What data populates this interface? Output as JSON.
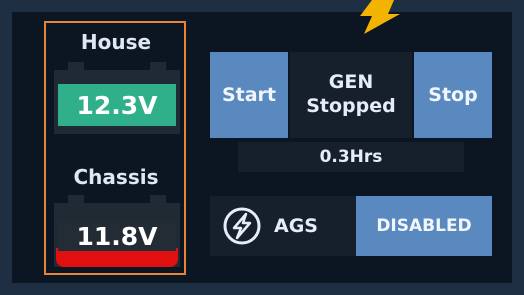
{
  "house": {
    "label": "House",
    "voltage": "12.3V",
    "color": "#2fb08a"
  },
  "chassis": {
    "label": "Chassis",
    "voltage": "11.8V",
    "bar_color": "#e01010"
  },
  "generator": {
    "start_label": "Start",
    "stop_label": "Stop",
    "status_line1": "GEN",
    "status_line2": "Stopped",
    "hours": "0.3Hrs"
  },
  "ags": {
    "label": "AGS",
    "status": "DISABLED",
    "icon": "lightning-circle-icon"
  },
  "colors": {
    "accent": "#5a89c0",
    "highlight": "#e8833a",
    "arrow": "#f2b400"
  }
}
